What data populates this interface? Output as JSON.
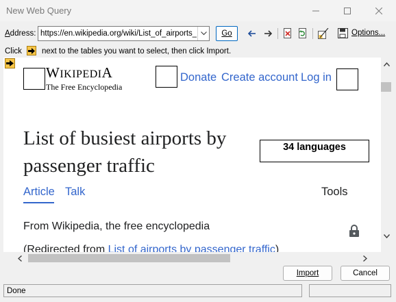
{
  "window": {
    "title": "New Web Query",
    "minimize_icon": "minimize-icon",
    "maximize_icon": "maximize-icon",
    "close_icon": "close-icon"
  },
  "address_bar": {
    "label_prefix": "A",
    "label_rest": "ddress:",
    "url": "https://en.wikipedia.org/wiki/List_of_airports_by_passenger_traffic",
    "go_label": "Go",
    "options_label": "Options..."
  },
  "toolbar": {
    "icons": [
      "back-arrow-icon",
      "forward-arrow-icon",
      "stop-icon",
      "refresh-icon",
      "hide-icons-icon",
      "save-query-icon"
    ]
  },
  "hint": {
    "before": "Click",
    "after": "next to the tables you want to select, then click Import."
  },
  "page": {
    "logo_name": "Wikipedia",
    "logo_tagline": "The Free Encyclopedia",
    "donate": "Donate",
    "create_account": "Create account",
    "log_in": "Log in",
    "title": "List of busiest airports by passenger traffic",
    "languages": "34 languages",
    "tab_article": "Article",
    "tab_talk": "Talk",
    "tools": "Tools",
    "from_text": "From Wikipedia, the free encyclopedia",
    "redirected_prefix": "(Redirected from ",
    "redirected_link": "List of airports by passenger traffic",
    "redirected_suffix": ")"
  },
  "buttons": {
    "import_label": "Import",
    "cancel_label": "Cancel"
  },
  "status": {
    "text": "Done"
  },
  "colors": {
    "link": "#3366cc",
    "select_arrow": "#f7c548",
    "go_border": "#0067c0"
  }
}
